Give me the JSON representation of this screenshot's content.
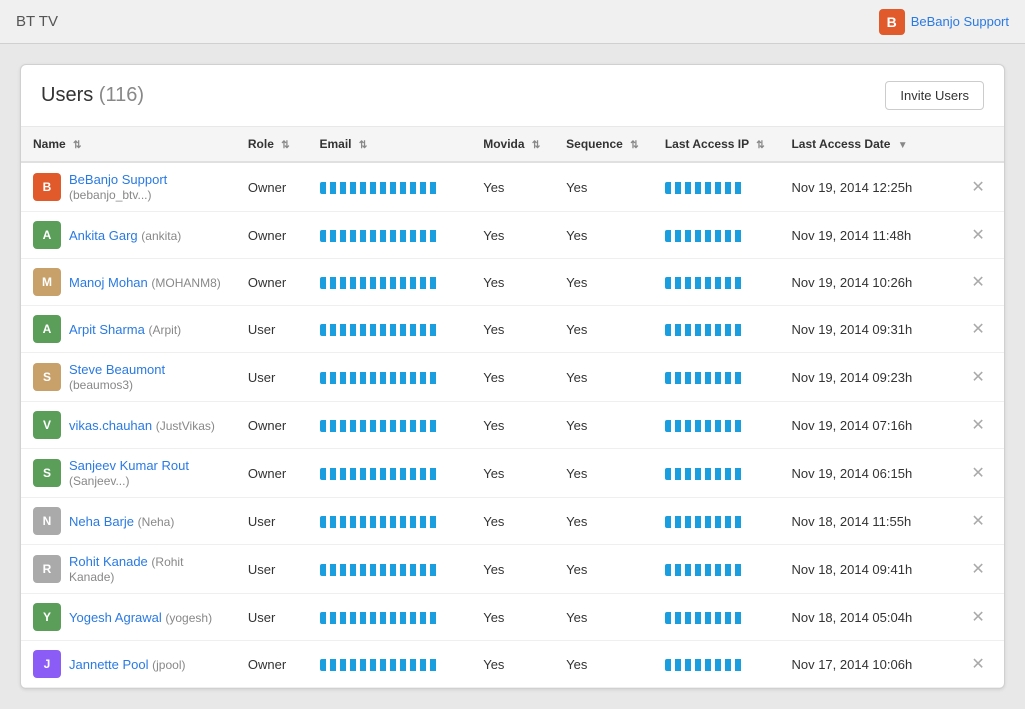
{
  "app": {
    "title": "BT TV",
    "support_label": "BeBanjo Support",
    "support_icon": "B"
  },
  "page": {
    "title": "Users",
    "count": "(116)",
    "invite_button": "Invite Users"
  },
  "table": {
    "columns": [
      {
        "id": "name",
        "label": "Name",
        "sort": true
      },
      {
        "id": "role",
        "label": "Role",
        "sort": true
      },
      {
        "id": "email",
        "label": "Email",
        "sort": true
      },
      {
        "id": "movida",
        "label": "Movida",
        "sort": true
      },
      {
        "id": "sequence",
        "label": "Sequence",
        "sort": true
      },
      {
        "id": "last_access_ip",
        "label": "Last Access IP",
        "sort": true
      },
      {
        "id": "last_access_date",
        "label": "Last Access Date",
        "sort": true
      },
      {
        "id": "action",
        "label": ""
      }
    ],
    "rows": [
      {
        "name": "BeBanjo Support",
        "username": "bebanjo_btv...",
        "role": "Owner",
        "movida": "Yes",
        "sequence": "Yes",
        "date": "Nov 19, 2014 12:25h",
        "avatar_color": "orange",
        "avatar_letter": "B"
      },
      {
        "name": "Ankita Garg",
        "username": "ankita",
        "role": "Owner",
        "movida": "Yes",
        "sequence": "Yes",
        "date": "Nov 19, 2014 11:48h",
        "avatar_color": "green",
        "avatar_letter": "A"
      },
      {
        "name": "Manoj Mohan",
        "username": "MOHANM8",
        "role": "Owner",
        "movida": "Yes",
        "sequence": "Yes",
        "date": "Nov 19, 2014 10:26h",
        "avatar_color": "tan",
        "avatar_letter": "M"
      },
      {
        "name": "Arpit Sharma",
        "username": "Arpit",
        "role": "User",
        "movida": "Yes",
        "sequence": "Yes",
        "date": "Nov 19, 2014 09:31h",
        "avatar_color": "green",
        "avatar_letter": "A"
      },
      {
        "name": "Steve Beaumont",
        "username": "beaumos3",
        "role": "User",
        "movida": "Yes",
        "sequence": "Yes",
        "date": "Nov 19, 2014 09:23h",
        "avatar_color": "tan",
        "avatar_letter": "S"
      },
      {
        "name": "vikas.chauhan",
        "username": "JustVikas",
        "role": "Owner",
        "movida": "Yes",
        "sequence": "Yes",
        "date": "Nov 19, 2014 07:16h",
        "avatar_color": "green",
        "avatar_letter": "V"
      },
      {
        "name": "Sanjeev Kumar Rout",
        "username": "Sanjeev...",
        "role": "Owner",
        "movida": "Yes",
        "sequence": "Yes",
        "date": "Nov 19, 2014 06:15h",
        "avatar_color": "green",
        "avatar_letter": "S"
      },
      {
        "name": "Neha Barje",
        "username": "Neha",
        "role": "User",
        "movida": "Yes",
        "sequence": "Yes",
        "date": "Nov 18, 2014 11:55h",
        "avatar_color": "gray",
        "avatar_letter": "N"
      },
      {
        "name": "Rohit Kanade",
        "username": "Rohit Kanade",
        "role": "User",
        "movida": "Yes",
        "sequence": "Yes",
        "date": "Nov 18, 2014 09:41h",
        "avatar_color": "gray",
        "avatar_letter": "R"
      },
      {
        "name": "Yogesh Agrawal",
        "username": "yogesh",
        "role": "User",
        "movida": "Yes",
        "sequence": "Yes",
        "date": "Nov 18, 2014 05:04h",
        "avatar_color": "green",
        "avatar_letter": "Y"
      },
      {
        "name": "Jannette Pool",
        "username": "jpool",
        "role": "Owner",
        "movida": "Yes",
        "sequence": "Yes",
        "date": "Nov 17, 2014 10:06h",
        "avatar_color": "purple",
        "avatar_letter": "J"
      }
    ]
  }
}
